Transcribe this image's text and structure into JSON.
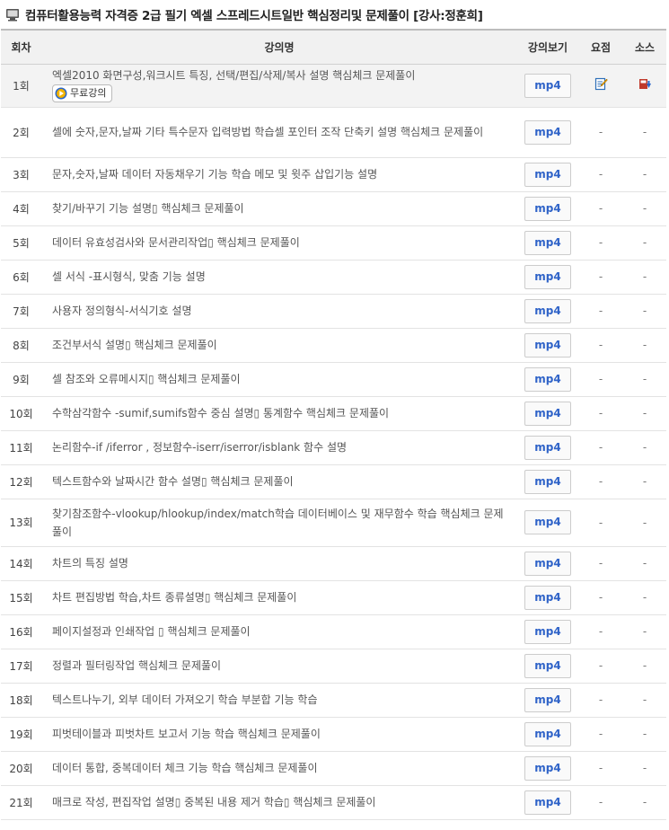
{
  "header": {
    "title": "컴퓨터활용능력 자격증 2급 필기 엑셀 스프레드시트일반 핵심정리및 문제풀이 [강사:정훈희]"
  },
  "table": {
    "columns": [
      "회차",
      "강의명",
      "강의보기",
      "요점",
      "소스"
    ],
    "mp4_label": "mp4",
    "dash": "-",
    "free_label": "무료강의",
    "rows": [
      {
        "num": "1회",
        "title": "엑셀2010 화면구성,워크시트 특징, 선택/편집/삭제/복사 설명 핵심체크 문제풀이"
      },
      {
        "num": "2회",
        "title": "셀에 숫자,문자,날짜 기타 특수문자 입력방법 학습셀 포인터 조작 단축키 설명 핵심체크 문제풀이"
      },
      {
        "num": "3회",
        "title": "문자,숫자,날짜 데이터 자동채우기 기능 학습 메모 및 윗주 삽입기능 설명"
      },
      {
        "num": "4회",
        "title": "찾기/바꾸기 기능 설명▯ 핵심체크 문제풀이"
      },
      {
        "num": "5회",
        "title": "데이터 유효성검사와 문서관리작업▯ 핵심체크 문제풀이"
      },
      {
        "num": "6회",
        "title": "셀 서식 -표시형식, 맞춤 기능 설명"
      },
      {
        "num": "7회",
        "title": "사용자 정의형식-서식기호 설명"
      },
      {
        "num": "8회",
        "title": "조건부서식 설명▯ 핵심체크 문제풀이"
      },
      {
        "num": "9회",
        "title": "셀 참조와 오류메시지▯ 핵심체크 문제풀이"
      },
      {
        "num": "10회",
        "title": "수학삼각함수 -sumif,sumifs함수 중심 설명▯ 통계함수 핵심체크 문제풀이"
      },
      {
        "num": "11회",
        "title": "논리함수-if /iferror , 정보함수-iserr/iserror/isblank 함수 설명"
      },
      {
        "num": "12회",
        "title": "텍스트함수와 날짜시간 함수 설명▯ 핵심체크 문제풀이"
      },
      {
        "num": "13회",
        "title": "찾기참조함수-vlookup/hlookup/index/match학습 데이터베이스 및 재무함수 학습 핵심체크 문제풀이"
      },
      {
        "num": "14회",
        "title": "차트의 특징 설명"
      },
      {
        "num": "15회",
        "title": "차트 편집방법 학습,차트 종류설명▯ 핵심체크 문제풀이"
      },
      {
        "num": "16회",
        "title": "페이지설정과 인쇄작업 ▯ 핵심체크 문제풀이"
      },
      {
        "num": "17회",
        "title": "정렬과 필터링작업 핵심체크 문제풀이"
      },
      {
        "num": "18회",
        "title": "텍스트나누기, 외부 데이터 가져오기 학습 부분합 기능 학습"
      },
      {
        "num": "19회",
        "title": "피벗테이블과 피벗차트 보고서 기능 학습 핵심체크 문제풀이"
      },
      {
        "num": "20회",
        "title": "데이터 통합, 중복데이터 체크 기능 학습 핵심체크 문제풀이"
      },
      {
        "num": "21회",
        "title": "매크로 작성, 편집작업 설명▯ 중복된 내용 제거 학습▯ 핵심체크 문제풀이"
      }
    ]
  }
}
